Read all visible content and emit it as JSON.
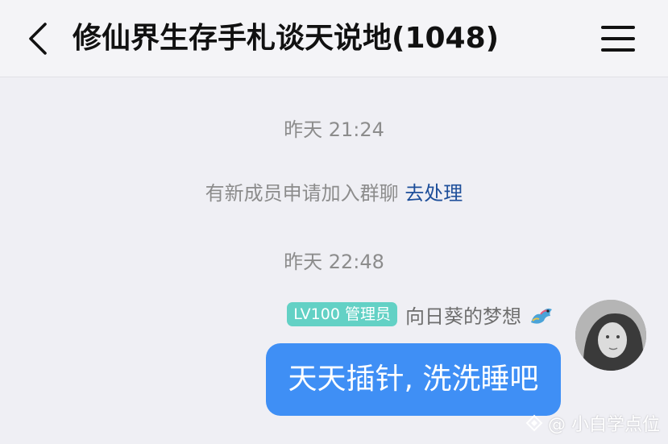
{
  "header": {
    "title": "修仙界生存手札谈天说地(1048)",
    "back_icon": "chevron-left-icon",
    "menu_icon": "hamburger-menu-icon"
  },
  "messages": {
    "time_1": "昨天 21:24",
    "notice_text": "有新成员申请加入群聊",
    "notice_link": "去处理",
    "time_2": "昨天 22:48",
    "sender": {
      "level_badge": "LV100 管理员",
      "name": "向日葵的梦想",
      "name_icon": "dragon-emoji-icon",
      "avatar": "avatar"
    },
    "bubble_text": "天天插针, 洗洗睡吧"
  },
  "watermark": {
    "text": "@ 小白学点位",
    "icon": "diamond-logo-icon"
  },
  "colors": {
    "bubble": "#3f8ff5",
    "badge": "#63d1c5",
    "link": "#1e4f9a",
    "background": "#efeff4"
  }
}
